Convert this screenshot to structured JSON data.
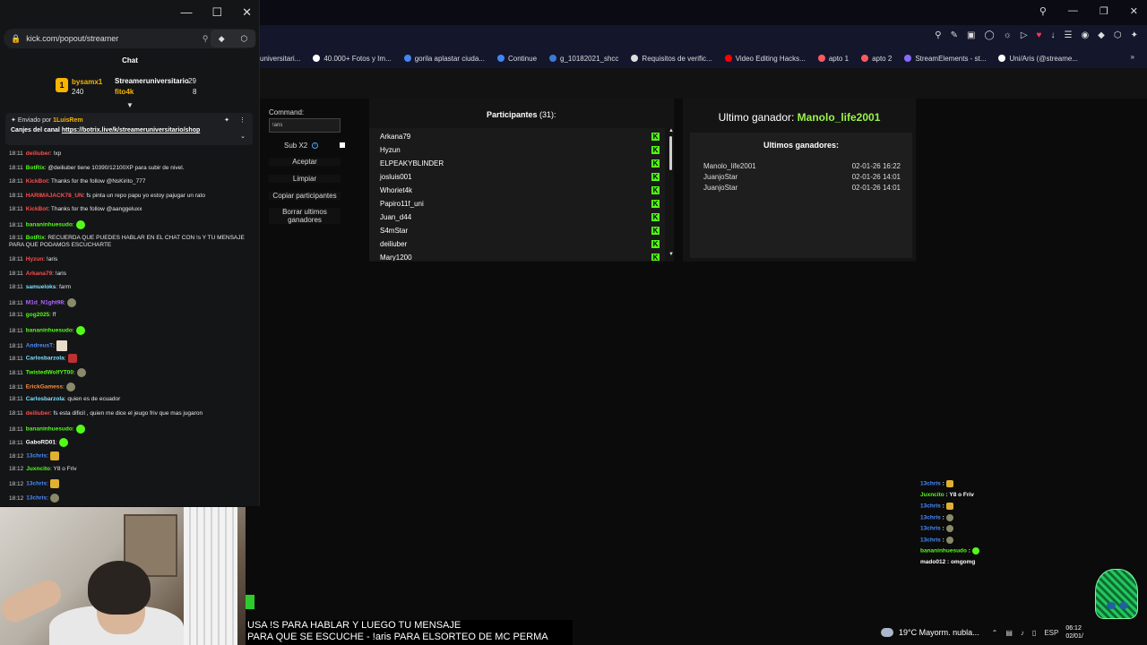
{
  "chat_window": {
    "url": "kick.com/popout/streamer",
    "title": "Chat",
    "leaderboard": {
      "user1": "bysamx1",
      "user1_score": "240",
      "user2": "Streameruniversitario",
      "user2_score": "29",
      "user3": "fito4k",
      "user3_score": "8"
    },
    "pinned": {
      "sent_by_label": "Enviado por",
      "sent_by_user": "1LuisRem",
      "text_prefix": "Canjes del canal",
      "link": "https://botrix.live/k/streameruniversitario/shop"
    },
    "messages": [
      {
        "time": "18:11",
        "user": "deiliuber",
        "text": ": !xp",
        "color": "#ff4d4d",
        "emote": ""
      },
      {
        "time": "18:11",
        "user": "BotRix",
        "text": ": @deiliuber tiene 10390/12100XP para subir de nivel.",
        "color": "#53fc18",
        "emote": ""
      },
      {
        "time": "18:11",
        "user": "KickBot",
        "text": ": Thanks for the follow @NsKirito_777",
        "color": "#ff4d4d",
        "emote": ""
      },
      {
        "time": "18:11",
        "user": "HARIMAJACK78_UN",
        "text": ": fs pinta un repo papu yo estoy pajugar un rato",
        "color": "#ff4d4d",
        "emote": ""
      },
      {
        "time": "18:11",
        "user": "KickBot",
        "text": ": Thanks for the follow @aanggeluxx",
        "color": "#ff4d4d",
        "emote": ""
      },
      {
        "time": "18:11",
        "user": "bananinhuesudo",
        "text": ":",
        "color": "#53fc18",
        "emote": "green"
      },
      {
        "time": "18:11",
        "user": "BotRix",
        "text": ": RECUERDA QUE PUEDES HABLAR EN EL CHAT CON !s Y TU MENSAJE PARA QUE PODAMOS ESCUCHARTE",
        "color": "#53fc18",
        "emote": ""
      },
      {
        "time": "18:11",
        "user": "Hyzun",
        "text": ": !aris",
        "color": "#ff4d4d",
        "emote": ""
      },
      {
        "time": "18:11",
        "user": "Arkana79",
        "text": ": !aris",
        "color": "#ff4d4d",
        "emote": ""
      },
      {
        "time": "18:11",
        "user": "samueloks",
        "text": ": farm",
        "color": "#7ee0ff",
        "emote": ""
      },
      {
        "time": "18:11",
        "user": "M1d_N1ght98",
        "text": ":",
        "color": "#b06bff",
        "emote": "face"
      },
      {
        "time": "18:11",
        "user": "gog2025",
        "text": ": ff",
        "color": "#53fc18",
        "emote": ""
      },
      {
        "time": "18:11",
        "user": "bananinhuesudo",
        "text": ":",
        "color": "#53fc18",
        "emote": "green"
      },
      {
        "time": "18:11",
        "user": "AndreusT",
        "text": ":",
        "color": "#4a8cff",
        "emote": "beige"
      },
      {
        "time": "18:11",
        "user": "Carlosbarzola",
        "text": ":",
        "color": "#7ee0ff",
        "emote": "red"
      },
      {
        "time": "18:11",
        "user": "TwistedWolfYT00",
        "text": ":",
        "color": "#53fc18",
        "emote": "face"
      },
      {
        "time": "18:11",
        "user": "ErickGamess",
        "text": ":",
        "color": "#ff8c3a",
        "emote": "face"
      },
      {
        "time": "18:11",
        "user": "Carlosbarzola",
        "text": ": quien es de ecuador",
        "color": "#7ee0ff",
        "emote": ""
      },
      {
        "time": "18:11",
        "user": "deiliuber",
        "text": ": fs esta dificil , quien me dice el jeugo friv que mas jugaron",
        "color": "#ff4d4d",
        "emote": ""
      },
      {
        "time": "18:11",
        "user": "bananinhuesudo",
        "text": ":",
        "color": "#53fc18",
        "emote": "green"
      },
      {
        "time": "18:11",
        "user": "GaboRD01",
        "text": ":",
        "color": "#ffffff",
        "emote": "green"
      },
      {
        "time": "18:12",
        "user": "13chris",
        "text": ":",
        "color": "#4a8cff",
        "emote": "gold"
      },
      {
        "time": "18:12",
        "user": "Juxncito",
        "text": ": Y8 o Friv",
        "color": "#53fc18",
        "emote": ""
      },
      {
        "time": "18:12",
        "user": "13chris",
        "text": ":",
        "color": "#4a8cff",
        "emote": "gold"
      },
      {
        "time": "18:12",
        "user": "13chris",
        "text": ":",
        "color": "#4a8cff",
        "emote": "face"
      }
    ]
  },
  "browser": {
    "bookmarks": [
      {
        "label": "universitari...",
        "color": "#888888"
      },
      {
        "label": "40.000+ Fotos y Im...",
        "color": "#ffffff"
      },
      {
        "label": "gorila aplastar ciuda...",
        "color": "#4285f4"
      },
      {
        "label": "Continue",
        "color": "#4285f4"
      },
      {
        "label": "g_10182021_shcc",
        "color": "#3a7bd5"
      },
      {
        "label": "Requisitos de verific...",
        "color": "#dddddd"
      },
      {
        "label": "Video Editing Hacks...",
        "color": "#ff0000"
      },
      {
        "label": "apto 1",
        "color": "#ff5a5f"
      },
      {
        "label": "apto 2",
        "color": "#ff5a5f"
      },
      {
        "label": "StreamElements - st...",
        "color": "#8a6aff"
      },
      {
        "label": "Uni/Aris (@streame...",
        "color": "#ffffff"
      }
    ]
  },
  "app": {
    "command_label": "Command:",
    "command_value": "!aris",
    "subx2_label": "Sub X2",
    "buttons": {
      "accept": "Aceptar",
      "clear": "Limpiar",
      "copy": "Copiar participantes",
      "delete_winners": "Borrar ultimos ganadores"
    },
    "participants_label": "Participantes",
    "participants_count": "(31):",
    "participants": [
      "Arkana79",
      "Hyzun",
      "ELPEAKYBLINDER",
      "josluis001",
      "Whoriet4k",
      "Papiro11f_uni",
      "Juan_d44",
      "S4mStar",
      "deiliuber",
      "Mary1200"
    ],
    "last_winner_label": "Ultimo ganador:",
    "last_winner": "Manolo_life2001",
    "winners_title": "Ultimos ganadores:",
    "winners": [
      {
        "name": "Manolo_life2001",
        "date": "02-01-26 16:22"
      },
      {
        "name": "JuanjoStar",
        "date": "02-01-26 14:01"
      },
      {
        "name": "JuanjoStar",
        "date": "02-01-26 14:01"
      }
    ]
  },
  "overlay_chat": [
    {
      "user": "13chris",
      "text": " :",
      "emote": "gold",
      "ucolor": "#4a8cff"
    },
    {
      "user": "Juxncito",
      "text": " : Y8 o Friv",
      "emote": "",
      "ucolor": "#53fc18"
    },
    {
      "user": "13chris",
      "text": " :",
      "emote": "gold",
      "ucolor": "#4a8cff"
    },
    {
      "user": "13chris",
      "text": " :",
      "emote": "face",
      "ucolor": "#4a8cff"
    },
    {
      "user": "13chris",
      "text": " :",
      "emote": "face",
      "ucolor": "#4a8cff"
    },
    {
      "user": "13chris",
      "text": " :",
      "emote": "face",
      "ucolor": "#4a8cff"
    },
    {
      "user": "bananinhuesudo",
      "text": " :",
      "emote": "green",
      "ucolor": "#53fc18"
    },
    {
      "user": "mado012",
      "text": " : omgomg",
      "emote": "",
      "ucolor": "#ffffff"
    }
  ],
  "banner": {
    "line1": "USA !S PARA HABLAR Y LUEGO TU MENSAJE",
    "line2": "PARA QUE SE ESCUCHE - !aris PARA ELSORTEO DE MC PERMA"
  },
  "taskbar": {
    "weather": "19°C  Mayorm. nubla...",
    "lang": "ESP",
    "time": "06:12",
    "date": "02/01/"
  },
  "colors": {
    "kick_green": "#53fc18",
    "winner_green": "#9bf24b"
  }
}
